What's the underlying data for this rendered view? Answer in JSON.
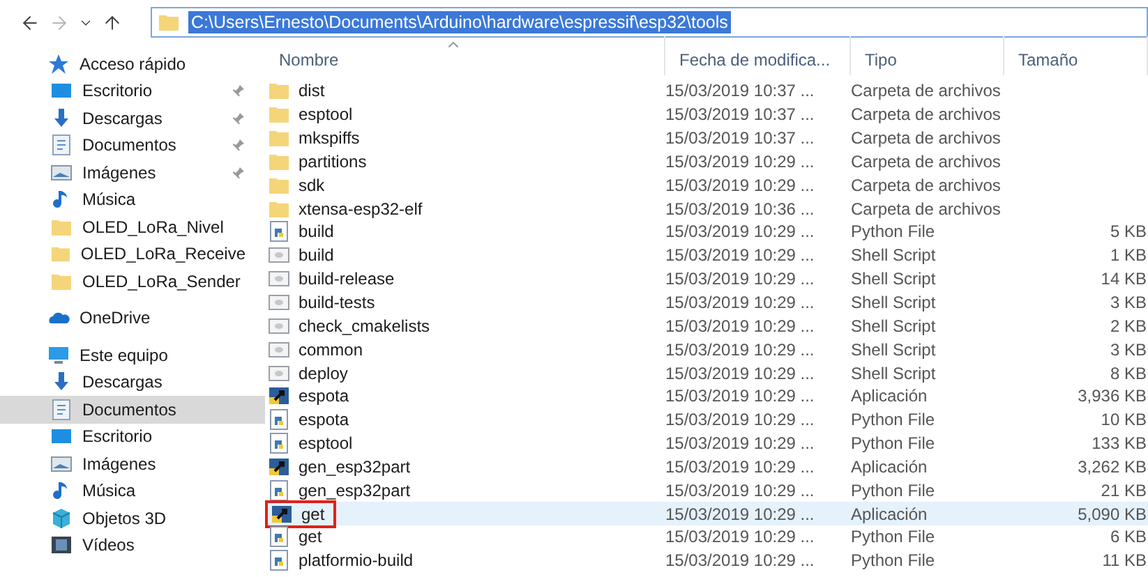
{
  "navigation": [
    {
      "kind": "back",
      "disabled": false
    },
    {
      "kind": "forward",
      "disabled": true
    },
    {
      "kind": "recent",
      "disabled": false
    },
    {
      "kind": "up",
      "disabled": false
    }
  ],
  "address_bar": {
    "value": "C:\\Users\\Ernesto\\Documents\\Arduino\\hardware\\espressif\\esp32\\tools",
    "text_selected": true
  },
  "sidebar": {
    "sections": [
      {
        "label": "Acceso rápido",
        "kind": "star",
        "selected": false,
        "children": [
          {
            "label": "Escritorio",
            "kind": "desktop",
            "pinned": true,
            "selected": false
          },
          {
            "label": "Descargas",
            "kind": "download",
            "pinned": true,
            "selected": false
          },
          {
            "label": "Documentos",
            "kind": "document",
            "pinned": true,
            "selected": false
          },
          {
            "label": "Imágenes",
            "kind": "image",
            "pinned": true,
            "selected": false
          },
          {
            "label": "Música",
            "kind": "music",
            "pinned": false,
            "selected": false
          },
          {
            "label": "OLED_LoRa_Nivel",
            "kind": "folder",
            "pinned": false,
            "selected": false
          },
          {
            "label": "OLED_LoRa_Receive",
            "kind": "folder",
            "pinned": false,
            "selected": false
          },
          {
            "label": "OLED_LoRa_Sender",
            "kind": "folder",
            "pinned": false,
            "selected": false
          }
        ]
      },
      {
        "label": "OneDrive",
        "kind": "cloud",
        "selected": false
      },
      {
        "label": "Este equipo",
        "kind": "computer",
        "selected": false,
        "children": [
          {
            "label": "Descargas",
            "kind": "download",
            "pinned": false,
            "selected": false
          },
          {
            "label": "Documentos",
            "kind": "document",
            "pinned": false,
            "selected": true
          },
          {
            "label": "Escritorio",
            "kind": "desktop",
            "pinned": false,
            "selected": false
          },
          {
            "label": "Imágenes",
            "kind": "image",
            "pinned": false,
            "selected": false
          },
          {
            "label": "Música",
            "kind": "music",
            "pinned": false,
            "selected": false
          },
          {
            "label": "Objetos 3D",
            "kind": "cube",
            "pinned": false,
            "selected": false
          },
          {
            "label": "Vídeos",
            "kind": "video",
            "pinned": false,
            "selected": false
          }
        ]
      }
    ]
  },
  "table": {
    "columns": [
      {
        "label": "Nombre",
        "sorted": true
      },
      {
        "label": "Fecha de modifica...",
        "sorted": false
      },
      {
        "label": "Tipo",
        "sorted": false
      },
      {
        "label": "Tamaño",
        "sorted": false
      }
    ],
    "rows": [
      {
        "kind": "folder",
        "name": "dist",
        "date": "15/03/2019 10:37 ...",
        "type": "Carpeta de archivos",
        "selected": false,
        "annotated": false
      },
      {
        "kind": "folder",
        "name": "esptool",
        "date": "15/03/2019 10:37 ...",
        "type": "Carpeta de archivos",
        "selected": false,
        "annotated": false
      },
      {
        "kind": "folder",
        "name": "mkspiffs",
        "date": "15/03/2019 10:37 ...",
        "type": "Carpeta de archivos",
        "selected": false,
        "annotated": false
      },
      {
        "kind": "folder",
        "name": "partitions",
        "date": "15/03/2019 10:29 ...",
        "type": "Carpeta de archivos",
        "selected": false,
        "annotated": false
      },
      {
        "kind": "folder",
        "name": "sdk",
        "date": "15/03/2019 10:29 ...",
        "type": "Carpeta de archivos",
        "selected": false,
        "annotated": false
      },
      {
        "kind": "folder",
        "name": "xtensa-esp32-elf",
        "date": "15/03/2019 10:36 ...",
        "type": "Carpeta de archivos",
        "selected": false,
        "annotated": false
      },
      {
        "kind": "python",
        "name": "build",
        "date": "15/03/2019 10:29 ...",
        "type": "Python File",
        "size": "5 KB",
        "selected": false,
        "annotated": false
      },
      {
        "kind": "shell",
        "name": "build",
        "date": "15/03/2019 10:29 ...",
        "type": "Shell Script",
        "size": "1 KB",
        "selected": false,
        "annotated": false
      },
      {
        "kind": "shell",
        "name": "build-release",
        "date": "15/03/2019 10:29 ...",
        "type": "Shell Script",
        "size": "14 KB",
        "selected": false,
        "annotated": false
      },
      {
        "kind": "shell",
        "name": "build-tests",
        "date": "15/03/2019 10:29 ...",
        "type": "Shell Script",
        "size": "3 KB",
        "selected": false,
        "annotated": false
      },
      {
        "kind": "shell",
        "name": "check_cmakelists",
        "date": "15/03/2019 10:29 ...",
        "type": "Shell Script",
        "size": "2 KB",
        "selected": false,
        "annotated": false
      },
      {
        "kind": "shell",
        "name": "common",
        "date": "15/03/2019 10:29 ...",
        "type": "Shell Script",
        "size": "3 KB",
        "selected": false,
        "annotated": false
      },
      {
        "kind": "shell",
        "name": "deploy",
        "date": "15/03/2019 10:29 ...",
        "type": "Shell Script",
        "size": "8 KB",
        "selected": false,
        "annotated": false
      },
      {
        "kind": "app",
        "name": "espota",
        "date": "15/03/2019 10:29 ...",
        "type": "Aplicación",
        "size": "3,936 KB",
        "selected": false,
        "annotated": false
      },
      {
        "kind": "python",
        "name": "espota",
        "date": "15/03/2019 10:29 ...",
        "type": "Python File",
        "size": "10 KB",
        "selected": false,
        "annotated": false
      },
      {
        "kind": "python",
        "name": "esptool",
        "date": "15/03/2019 10:29 ...",
        "type": "Python File",
        "size": "133 KB",
        "selected": false,
        "annotated": false
      },
      {
        "kind": "app",
        "name": "gen_esp32part",
        "date": "15/03/2019 10:29 ...",
        "type": "Aplicación",
        "size": "3,262 KB",
        "selected": false,
        "annotated": false
      },
      {
        "kind": "python",
        "name": "gen_esp32part",
        "date": "15/03/2019 10:29 ...",
        "type": "Python File",
        "size": "21 KB",
        "selected": false,
        "annotated": false
      },
      {
        "kind": "app",
        "name": "get",
        "date": "15/03/2019 10:29 ...",
        "type": "Aplicación",
        "size": "5,090 KB",
        "selected": true,
        "annotated": true
      },
      {
        "kind": "python",
        "name": "get",
        "date": "15/03/2019 10:29 ...",
        "type": "Python File",
        "size": "6 KB",
        "selected": false,
        "annotated": false
      },
      {
        "kind": "python",
        "name": "platformio-build",
        "date": "15/03/2019 10:29 ...",
        "type": "Python File",
        "size": "11 KB",
        "selected": false,
        "annotated": false
      }
    ]
  }
}
